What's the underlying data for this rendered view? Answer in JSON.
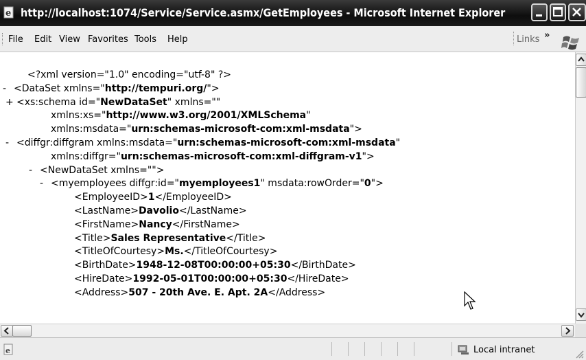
{
  "window": {
    "title": "http://localhost:1074/Service/Service.asmx/GetEmployees - Microsoft Internet Explorer"
  },
  "menu": {
    "items": [
      "File",
      "Edit",
      "View",
      "Favorites",
      "Tools",
      "Help"
    ],
    "links_label": "Links",
    "chevron": "»"
  },
  "xml_lines": [
    {
      "t": "<?xml version=\"1.0\" encoding=\"utf-8\" ?>"
    },
    {
      "toggle": "-",
      "t": "<DataSet xmlns=\"",
      "v": "http://tempuri.org/",
      "e": "\">"
    },
    {
      "toggle": "+",
      "t": "<xs:schema id=\"",
      "v": "NewDataSet",
      "e": "\" xmlns=\"\""
    },
    {
      "t": "xmlns:xs=\"",
      "v": "http://www.w3.org/2001/XMLSchema",
      "e": "\""
    },
    {
      "t": "xmlns:msdata=\"",
      "v": "urn:schemas-microsoft-com:xml-msdata",
      "e": "\">"
    },
    {
      "toggle": "-",
      "t": "<diffgr:diffgram xmlns:msdata=\"",
      "v": "urn:schemas-microsoft-com:xml-msdata",
      "e": "\""
    },
    {
      "t": "xmlns:diffgr=\"",
      "v": "urn:schemas-microsoft-com:xml-diffgram-v1",
      "e": "\">"
    },
    {
      "toggle": "-",
      "t": "<NewDataSet xmlns=\"\">"
    },
    {
      "toggle": "-",
      "t": "<myemployees diffgr:id=\"",
      "v": "myemployees1",
      "e": "\" msdata:rowOrder=\"",
      "v2": "0",
      "e2": "\">"
    },
    {
      "t": "<EmployeeID>",
      "v": "1",
      "e": "</EmployeeID>"
    },
    {
      "t": "<LastName>",
      "v": "Davolio",
      "e": "</LastName>"
    },
    {
      "t": "<FirstName>",
      "v": "Nancy",
      "e": "</FirstName>"
    },
    {
      "t": "<Title>",
      "v": "Sales Representative",
      "e": "</Title>"
    },
    {
      "t": "<TitleOfCourtesy>",
      "v": "Ms.",
      "e": "</TitleOfCourtesy>"
    },
    {
      "t": "<BirthDate>",
      "v": "1948-12-08T00:00:00+05:30",
      "e": "</BirthDate>"
    },
    {
      "t": "<HireDate>",
      "v": "1992-05-01T00:00:00+05:30",
      "e": "</HireDate>"
    },
    {
      "t": "<Address>",
      "v": "507 - 20th Ave. E. Apt. 2A",
      "e": "</Address>"
    }
  ],
  "status": {
    "zone": "Local intranet"
  }
}
